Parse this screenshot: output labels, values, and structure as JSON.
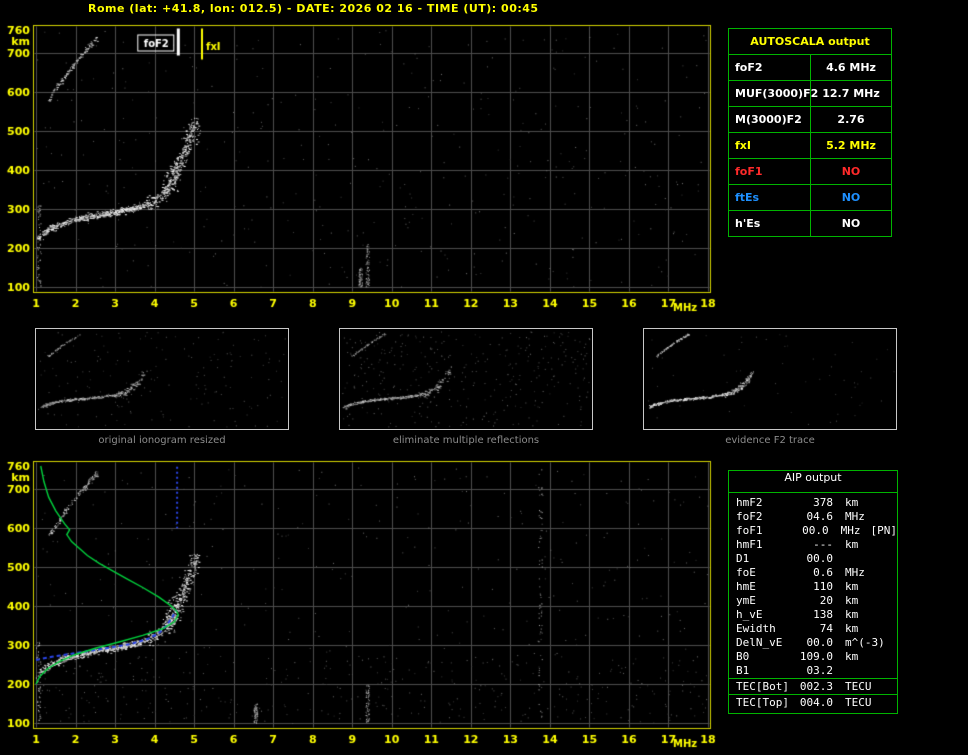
{
  "header": {
    "title": "Rome (lat: +41.8, lon: 012.5) - DATE: 2026 02 16 - TIME (UT): 00:45"
  },
  "colors": {
    "background": "#000000",
    "axis_yellow": "#ffff00",
    "plot_border": "#d6d600",
    "grid_gray": "#4e4e4e",
    "table_green": "#00b400",
    "profile_green": "#00d23c",
    "trace_blue": "#2b46e8",
    "value_red": "#ff2a2a",
    "value_blue": "#1e90ff",
    "caption_gray": "#8c8c8c"
  },
  "autoscala": {
    "title": "AUTOSCALA output",
    "rows": [
      {
        "label": "foF2",
        "value": "4.6 MHz",
        "color": "#ffffff"
      },
      {
        "label": "MUF(3000)F2",
        "value": "12.7 MHz",
        "color": "#ffffff"
      },
      {
        "label": "M(3000)F2",
        "value": "2.76",
        "color": "#ffffff"
      },
      {
        "label": "fxI",
        "value": "5.2 MHz",
        "color": "#ffff00"
      },
      {
        "label": "foF1",
        "value": "NO",
        "color": "#ff2a2a"
      },
      {
        "label": "ftEs",
        "value": "NO",
        "color": "#1e90ff"
      },
      {
        "label": "h'Es",
        "value": "NO",
        "color": "#ffffff"
      }
    ]
  },
  "thumbnails": {
    "captions": [
      "original ionogram resized",
      "eliminate multiple reflections",
      "evidence F2 trace"
    ]
  },
  "aip": {
    "title": "AIP output",
    "rows": [
      {
        "name": "hmF2",
        "value": "378",
        "unit": "km",
        "note": ""
      },
      {
        "name": "foF2",
        "value": "04.6",
        "unit": "MHz",
        "note": ""
      },
      {
        "name": "foF1",
        "value": "00.0",
        "unit": "MHz",
        "note": "[PN]"
      },
      {
        "name": "hmF1",
        "value": "---",
        "unit": "km",
        "note": ""
      },
      {
        "name": "D1",
        "value": "00.0",
        "unit": "",
        "note": ""
      },
      {
        "name": "foE",
        "value": "0.6",
        "unit": "MHz",
        "note": ""
      },
      {
        "name": "hmE",
        "value": "110",
        "unit": "km",
        "note": ""
      },
      {
        "name": "ymE",
        "value": "20",
        "unit": "km",
        "note": ""
      },
      {
        "name": "h_vE",
        "value": "138",
        "unit": "km",
        "note": ""
      },
      {
        "name": "Ewidth",
        "value": "74",
        "unit": "km",
        "note": ""
      },
      {
        "name": "DelN_vE",
        "value": "00.0",
        "unit": "m^(-3)",
        "note": ""
      },
      {
        "name": "B0",
        "value": "109.0",
        "unit": "km",
        "note": ""
      },
      {
        "name": "B1",
        "value": "03.2",
        "unit": "",
        "note": ""
      },
      {
        "name": "TEC[Bot]",
        "value": "002.3",
        "unit": "TECU",
        "note": "",
        "sep": true
      },
      {
        "name": "TEC[Top]",
        "value": "004.0",
        "unit": "TECU",
        "note": "",
        "sep": true
      }
    ]
  },
  "chart_data": [
    {
      "id": "top-ionogram",
      "type": "scatter",
      "xlabel": "MHz",
      "ylabel": "km",
      "xlim": [
        1,
        18
      ],
      "ylim": [
        100,
        760
      ],
      "xticks": [
        1,
        2,
        3,
        4,
        5,
        6,
        7,
        8,
        9,
        10,
        11,
        12,
        13,
        14,
        15,
        16,
        17,
        18
      ],
      "yticks": [
        760,
        700,
        600,
        500,
        400,
        300,
        200,
        100
      ],
      "ygrid": [
        100,
        200,
        300,
        400,
        500,
        600,
        700
      ],
      "grid": true,
      "seed": 7,
      "markers": [
        {
          "label": "foF2",
          "mhz": 4.6,
          "color": "#ffffff"
        },
        {
          "label": "fxI",
          "mhz": 5.2,
          "color": "#ffff00"
        }
      ],
      "f2_trace": [
        [
          1.05,
          225
        ],
        [
          1.3,
          248
        ],
        [
          1.6,
          262
        ],
        [
          2.0,
          274
        ],
        [
          2.4,
          283
        ],
        [
          2.8,
          290
        ],
        [
          3.2,
          297
        ],
        [
          3.6,
          306
        ],
        [
          3.9,
          318
        ],
        [
          4.15,
          335
        ],
        [
          4.35,
          358
        ],
        [
          4.55,
          390
        ],
        [
          4.7,
          425
        ],
        [
          4.8,
          455
        ],
        [
          4.9,
          485
        ],
        [
          4.95,
          505
        ]
      ],
      "second_hop": [
        [
          1.35,
          585
        ],
        [
          1.5,
          610
        ],
        [
          1.65,
          632
        ],
        [
          1.8,
          652
        ],
        [
          1.95,
          672
        ],
        [
          2.1,
          692
        ],
        [
          2.3,
          715
        ],
        [
          2.5,
          738
        ]
      ],
      "noise_columns": [
        {
          "mhz": 9.38,
          "km_range": [
            100,
            215
          ]
        },
        {
          "mhz": 9.2,
          "km_range": [
            100,
            150
          ]
        }
      ]
    },
    {
      "id": "bottom-ionogram",
      "type": "scatter",
      "xlabel": "MHz",
      "ylabel": "km",
      "xlim": [
        1,
        18
      ],
      "ylim": [
        100,
        760
      ],
      "xticks": [
        1,
        2,
        3,
        4,
        5,
        6,
        7,
        8,
        9,
        10,
        11,
        12,
        13,
        14,
        15,
        16,
        17,
        18
      ],
      "yticks": [
        760,
        700,
        600,
        500,
        400,
        300,
        200,
        100
      ],
      "ygrid": [
        100,
        200,
        300,
        400,
        500,
        600,
        700
      ],
      "grid": true,
      "seed": 13,
      "low_band_noise": true,
      "f2_trace": [
        [
          1.05,
          225
        ],
        [
          1.3,
          248
        ],
        [
          1.6,
          262
        ],
        [
          2.0,
          274
        ],
        [
          2.4,
          283
        ],
        [
          2.8,
          290
        ],
        [
          3.2,
          297
        ],
        [
          3.6,
          306
        ],
        [
          3.9,
          318
        ],
        [
          4.15,
          335
        ],
        [
          4.35,
          358
        ],
        [
          4.55,
          390
        ],
        [
          4.7,
          425
        ],
        [
          4.8,
          455
        ],
        [
          4.9,
          485
        ],
        [
          4.95,
          505
        ]
      ],
      "second_hop": [
        [
          1.35,
          585
        ],
        [
          1.5,
          610
        ],
        [
          1.65,
          632
        ],
        [
          1.8,
          652
        ],
        [
          1.95,
          672
        ],
        [
          2.1,
          692
        ],
        [
          2.3,
          715
        ],
        [
          2.5,
          738
        ]
      ],
      "profile_green": [
        [
          1.12,
          760
        ],
        [
          1.2,
          720
        ],
        [
          1.32,
          680
        ],
        [
          1.5,
          645
        ],
        [
          1.72,
          612
        ],
        [
          1.85,
          596
        ],
        [
          1.78,
          584
        ],
        [
          1.9,
          566
        ],
        [
          2.1,
          548
        ],
        [
          2.3,
          530
        ],
        [
          2.6,
          510
        ],
        [
          2.95,
          490
        ],
        [
          3.3,
          470
        ],
        [
          3.7,
          448
        ],
        [
          4.1,
          424
        ],
        [
          4.4,
          402
        ],
        [
          4.55,
          388
        ],
        [
          4.6,
          378
        ],
        [
          4.5,
          360
        ],
        [
          4.2,
          342
        ],
        [
          3.7,
          325
        ],
        [
          3.1,
          308
        ],
        [
          2.5,
          292
        ],
        [
          2.0,
          276
        ],
        [
          1.6,
          258
        ],
        [
          1.3,
          240
        ],
        [
          1.1,
          220
        ],
        [
          1.0,
          200
        ]
      ],
      "trace_blue": [
        [
          1.0,
          262
        ],
        [
          1.4,
          270
        ],
        [
          1.9,
          278
        ],
        [
          2.4,
          286
        ],
        [
          2.9,
          294
        ],
        [
          3.4,
          303
        ],
        [
          3.8,
          315
        ],
        [
          4.1,
          330
        ],
        [
          4.3,
          350
        ],
        [
          4.45,
          372
        ],
        [
          4.55,
          390
        ]
      ],
      "topside_blue": {
        "mhz": 4.57,
        "km_range": [
          600,
          758
        ]
      },
      "noise_columns": [
        {
          "mhz": 9.38,
          "km_range": [
            100,
            200
          ]
        },
        {
          "mhz": 6.55,
          "km_range": [
            100,
            150
          ]
        },
        {
          "mhz": 13.75,
          "km_range": [
            100,
            760
          ]
        }
      ]
    }
  ]
}
